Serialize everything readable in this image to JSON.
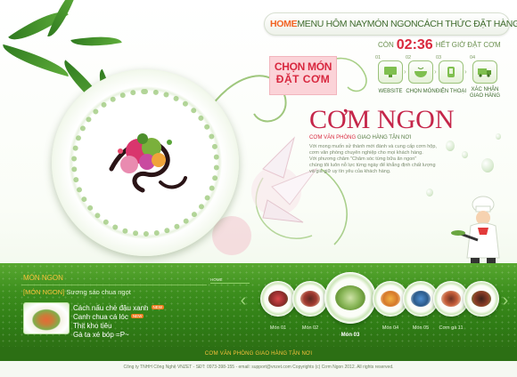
{
  "nav": {
    "items": [
      {
        "label": "HOME",
        "active": true
      },
      {
        "label": "MENU HÔM NAY",
        "active": false
      },
      {
        "label": "MÓN NGON",
        "active": false
      },
      {
        "label": "CÁCH THỨC ĐẶT HÀNG",
        "active": false
      }
    ]
  },
  "countdown": {
    "prefix": "CÒN",
    "time": "02:36",
    "suffix": "HẾT GIỜ ĐẶT CƠM"
  },
  "order_box": {
    "line1": "CHỌN MÓN",
    "line2": "ĐẶT CƠM"
  },
  "steps": [
    {
      "num": "01",
      "label": "WEBSITE",
      "icon": "monitor-icon"
    },
    {
      "num": "02",
      "label": "CHỌN MÓN",
      "icon": "bowl-icon"
    },
    {
      "num": "03",
      "label": "ĐIỆN THOẠI",
      "icon": "phone-icon"
    },
    {
      "num": "04",
      "label": "XÁC NHẬN GIAO HÀNG",
      "icon": "truck-icon"
    }
  ],
  "brand": {
    "title": "CƠM NGON",
    "subtitle_accent": "CƠM VĂN PHÒNG",
    "subtitle": "GIAO HÀNG TẬN NƠI",
    "description": [
      "Với mong muốn sử thành mới đành và cung cấp cơm hộp,",
      "cơm văn phòng chuyên nghiệp cho mọi khách hàng.",
      "Với phương châm \"Chăm sóc từng bữa ăn ngon\"",
      "chúng tôi luôn nỗ lực từng ngày để khẳng định chất lượng",
      "và giá giữ uy tín yêu của khách hàng."
    ]
  },
  "news": {
    "header": "MÓN NGON",
    "featured_tag": "[MÓN NGON]",
    "featured_text": "Sương sáo chua ngọt",
    "items": [
      {
        "label": "Cách nấu chè đậu xanh",
        "badge": "NEW"
      },
      {
        "label": "Canh chua cá lóc",
        "badge": "NEW"
      },
      {
        "label": "Thịt kho tiêu",
        "badge": ""
      },
      {
        "label": "Gà ta xé bóp =P~",
        "badge": ""
      }
    ]
  },
  "breadcrumb": "HOME",
  "carousel": {
    "prev_icon": "chevron-left-icon",
    "next_icon": "chevron-right-icon",
    "items": [
      {
        "label": "Món 01",
        "active": false
      },
      {
        "label": "Món 02",
        "active": false
      },
      {
        "label": "Món 03",
        "active": true
      },
      {
        "label": "Món 04",
        "active": false
      },
      {
        "label": "Món 05",
        "active": false
      },
      {
        "label": "Cơm gà 11",
        "active": false
      }
    ]
  },
  "footer": {
    "tagline": "CƠM VĂN PHÒNG GIAO HÀNG TẬN NƠI",
    "info": "Công ty TNHH Công Nghệ VNZET - SĐT: 0973-398-155 - email: support@vnzet.com    Copyrights (c) Cơm Ngon 2012. All rights reserved."
  },
  "colors": {
    "accent": "#d8283f",
    "nav_active": "#f26322",
    "green": "#3c8e1d",
    "gold": "#f9c23c"
  }
}
